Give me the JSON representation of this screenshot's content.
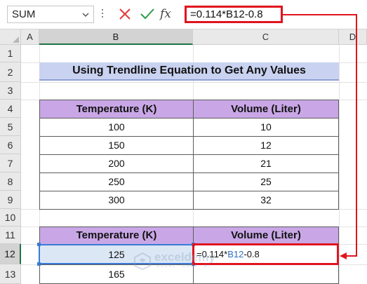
{
  "formula_bar": {
    "name_box": "SUM",
    "formula": "=0.114*B12-0.8",
    "fx_label": "fx"
  },
  "columns": [
    "A",
    "B",
    "C",
    "D"
  ],
  "rows": [
    "1",
    "2",
    "3",
    "4",
    "5",
    "6",
    "7",
    "8",
    "9",
    "10",
    "11",
    "12",
    "13"
  ],
  "title": "Using Trendline Equation to Get Any Values",
  "table1": {
    "headers": [
      "Temperature (K)",
      "Volume (Liter)"
    ],
    "rows": [
      [
        "100",
        "10"
      ],
      [
        "150",
        "12"
      ],
      [
        "200",
        "21"
      ],
      [
        "250",
        "25"
      ],
      [
        "300",
        "32"
      ]
    ]
  },
  "table2": {
    "headers": [
      "Temperature (K)",
      "Volume (Liter)"
    ],
    "b12": "125",
    "c12_formula": {
      "prefix": "=0.114*",
      "ref": "B12",
      "suffix": "-0.8"
    },
    "b13": "165"
  },
  "watermark": {
    "name": "exceldemy",
    "tagline": "EXCEL · DATA · BI"
  },
  "colors": {
    "header_purple": "#c9a7e6",
    "title_blue": "#c9d2f0",
    "highlight_red": "#e0141e",
    "ref_blue": "#2f6fc2"
  }
}
